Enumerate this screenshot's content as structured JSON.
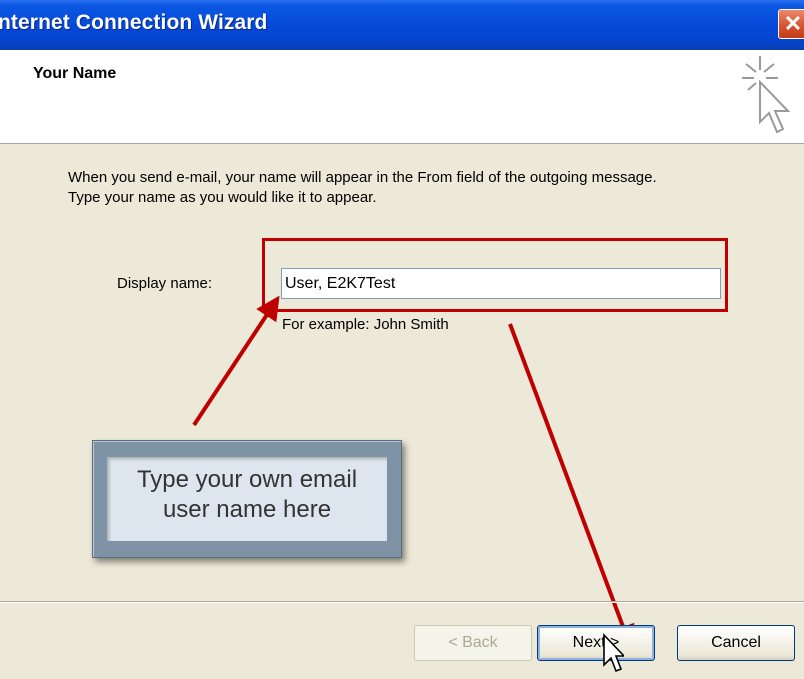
{
  "window": {
    "title": "nternet Connection Wizard",
    "close_glyph": "✕"
  },
  "header": {
    "title": "Your Name",
    "icon": "wizard-sparkle-cursor-icon"
  },
  "content": {
    "intro_line1": "When you send e-mail, your name will appear in the From field of the outgoing message.",
    "intro_line2": "Type your name as you would like it to appear.",
    "display_name_label": "Display name:",
    "display_name_value": "User, E2K7Test",
    "example_text": "For example: John Smith"
  },
  "annotation": {
    "callout_text": "Type your own email user name here",
    "highlight_color": "#c00000"
  },
  "buttons": {
    "back_label": "< Back",
    "next_label": "Next >",
    "cancel_label": "Cancel"
  },
  "colors": {
    "titlebar": "#0548d8",
    "dialog_bg": "#ece9d8",
    "arrow": "#c00000"
  }
}
